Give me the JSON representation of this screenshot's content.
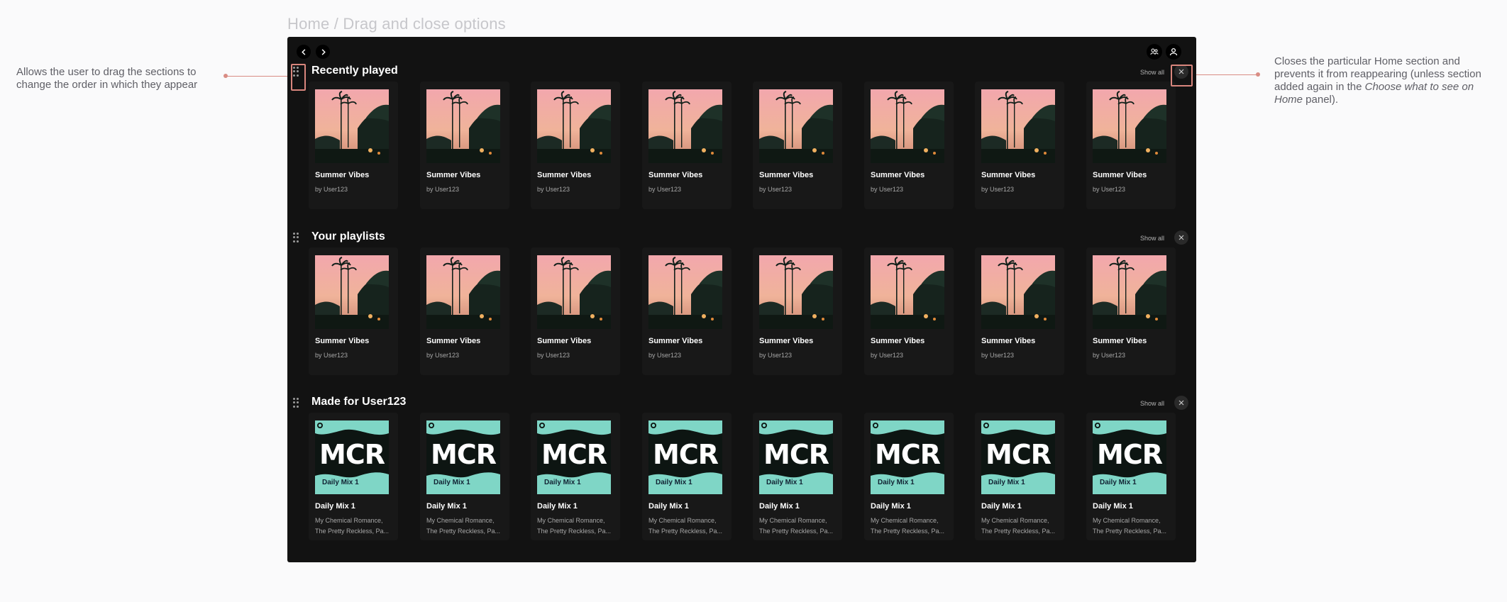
{
  "page_title": "Home / Drag and close options",
  "annotations": {
    "left": "Allows the user to drag the sections to change the order in which they appear",
    "right_pre": "Closes the particular Home section and prevents it from reappearing (unless section added again in the ",
    "right_em": "Choose what to see on Home",
    "right_post": " panel)."
  },
  "colors": {
    "accent": "#d9867d",
    "panel": "#121212",
    "card": "#181818",
    "mix_teal": "#7fd6c6"
  },
  "topbar": {
    "back_icon": "chevron-left-icon",
    "forward_icon": "chevron-right-icon",
    "friends_icon": "friends-icon",
    "user_icon": "user-icon"
  },
  "sections": [
    {
      "title": "Recently played",
      "show_all": "Show all",
      "cards": [
        {
          "title": "Summer Vibes",
          "sub": "by User123"
        },
        {
          "title": "Summer Vibes",
          "sub": "by User123"
        },
        {
          "title": "Summer Vibes",
          "sub": "by User123"
        },
        {
          "title": "Summer Vibes",
          "sub": "by User123"
        },
        {
          "title": "Summer Vibes",
          "sub": "by User123"
        },
        {
          "title": "Summer Vibes",
          "sub": "by User123"
        },
        {
          "title": "Summer Vibes",
          "sub": "by User123"
        },
        {
          "title": "Summer Vibes",
          "sub": "by User123"
        }
      ]
    },
    {
      "title": "Your playlists",
      "show_all": "Show all",
      "cards": [
        {
          "title": "Summer Vibes",
          "sub": "by User123"
        },
        {
          "title": "Summer Vibes",
          "sub": "by User123"
        },
        {
          "title": "Summer Vibes",
          "sub": "by User123"
        },
        {
          "title": "Summer Vibes",
          "sub": "by User123"
        },
        {
          "title": "Summer Vibes",
          "sub": "by User123"
        },
        {
          "title": "Summer Vibes",
          "sub": "by User123"
        },
        {
          "title": "Summer Vibes",
          "sub": "by User123"
        },
        {
          "title": "Summer Vibes",
          "sub": "by User123"
        }
      ]
    },
    {
      "title": "Made for User123",
      "show_all": "Show all",
      "cards": [
        {
          "title": "Daily Mix 1",
          "cover_word": "MCR",
          "cover_label": "Daily Mix 1",
          "sub1": "My Chemical Romance,",
          "sub2": "The Pretty Reckless, Pa..."
        },
        {
          "title": "Daily Mix 1",
          "cover_word": "MCR",
          "cover_label": "Daily Mix 1",
          "sub1": "My Chemical Romance,",
          "sub2": "The Pretty Reckless, Pa..."
        },
        {
          "title": "Daily Mix 1",
          "cover_word": "MCR",
          "cover_label": "Daily Mix 1",
          "sub1": "My Chemical Romance,",
          "sub2": "The Pretty Reckless, Pa..."
        },
        {
          "title": "Daily Mix 1",
          "cover_word": "MCR",
          "cover_label": "Daily Mix 1",
          "sub1": "My Chemical Romance,",
          "sub2": "The Pretty Reckless, Pa..."
        },
        {
          "title": "Daily Mix 1",
          "cover_word": "MCR",
          "cover_label": "Daily Mix 1",
          "sub1": "My Chemical Romance,",
          "sub2": "The Pretty Reckless, Pa..."
        },
        {
          "title": "Daily Mix 1",
          "cover_word": "MCR",
          "cover_label": "Daily Mix 1",
          "sub1": "My Chemical Romance,",
          "sub2": "The Pretty Reckless, Pa..."
        },
        {
          "title": "Daily Mix 1",
          "cover_word": "MCR",
          "cover_label": "Daily Mix 1",
          "sub1": "My Chemical Romance,",
          "sub2": "The Pretty Reckless, Pa..."
        },
        {
          "title": "Daily Mix 1",
          "cover_word": "MCR",
          "cover_label": "Daily Mix 1",
          "sub1": "My Chemical Romance,",
          "sub2": "The Pretty Reckless, Pa..."
        }
      ]
    }
  ]
}
